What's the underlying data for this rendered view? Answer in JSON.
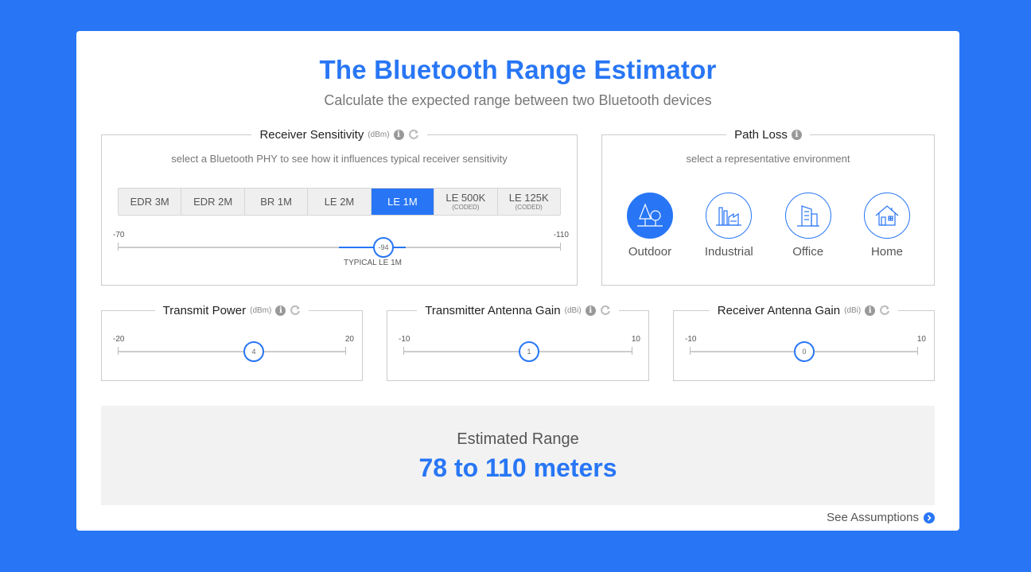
{
  "title": "The Bluetooth Range Estimator",
  "subtitle": "Calculate the expected range between two Bluetooth devices",
  "receiver_sensitivity": {
    "title": "Receiver Sensitivity",
    "unit": "(dBm)",
    "hint": "select a Bluetooth PHY to see how it influences typical receiver sensitivity",
    "phy_options": [
      {
        "label": "EDR 3M",
        "sub": ""
      },
      {
        "label": "EDR 2M",
        "sub": ""
      },
      {
        "label": "BR 1M",
        "sub": ""
      },
      {
        "label": "LE 2M",
        "sub": ""
      },
      {
        "label": "LE 1M",
        "sub": ""
      },
      {
        "label": "LE 500K",
        "sub": "(CODED)"
      },
      {
        "label": "LE 125K",
        "sub": "(CODED)"
      }
    ],
    "selected_phy": "LE 1M",
    "slider": {
      "min": "-70",
      "max": "-110",
      "value": "-94",
      "value_num": -94,
      "typical_label": "TYPICAL LE 1M"
    }
  },
  "path_loss": {
    "title": "Path Loss",
    "hint": "select a representative environment",
    "environments": [
      {
        "label": "Outdoor",
        "icon": "trees-icon"
      },
      {
        "label": "Industrial",
        "icon": "factory-icon"
      },
      {
        "label": "Office",
        "icon": "office-building-icon"
      },
      {
        "label": "Home",
        "icon": "house-icon"
      }
    ],
    "selected": "Outdoor"
  },
  "transmit_power": {
    "title": "Transmit Power",
    "unit": "(dBm)",
    "min": "-20",
    "max": "20",
    "value": "4",
    "value_num": 4
  },
  "tx_antenna_gain": {
    "title": "Transmitter Antenna Gain",
    "unit": "(dBi)",
    "min": "-10",
    "max": "10",
    "value": "1",
    "value_num": 1
  },
  "rx_antenna_gain": {
    "title": "Receiver Antenna Gain",
    "unit": "(dBi)",
    "min": "-10",
    "max": "10",
    "value": "0",
    "value_num": 0
  },
  "result": {
    "label": "Estimated Range",
    "value": "78 to 110 meters"
  },
  "see_assumptions": "See Assumptions",
  "colors": {
    "accent": "#2876f5",
    "background": "#2876f5",
    "result_bg": "#f2f2f2"
  }
}
